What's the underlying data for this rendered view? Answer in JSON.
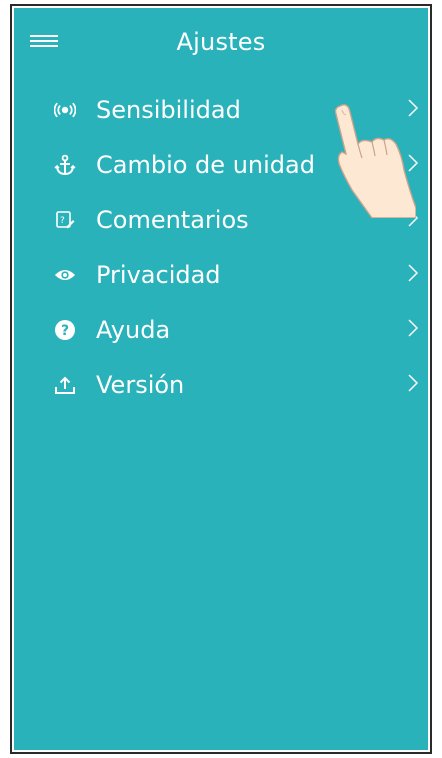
{
  "header": {
    "title": "Ajustes",
    "menu_icon": "hamburger-menu-icon"
  },
  "menu": {
    "items": [
      {
        "label": "Sensibilidad",
        "icon": "broadcast-icon"
      },
      {
        "label": "Cambio de unidad",
        "icon": "anchor-icon"
      },
      {
        "label": "Comentarios",
        "icon": "feedback-icon"
      },
      {
        "label": "Privacidad",
        "icon": "eye-icon"
      },
      {
        "label": "Ayuda",
        "icon": "help-icon"
      },
      {
        "label": "Versión",
        "icon": "upload-icon"
      }
    ],
    "chevron_icon": "chevron-right-icon"
  },
  "colors": {
    "background": "#2ab2bb",
    "foreground": "#ffffff",
    "hand_skin": "#fde8d4"
  }
}
